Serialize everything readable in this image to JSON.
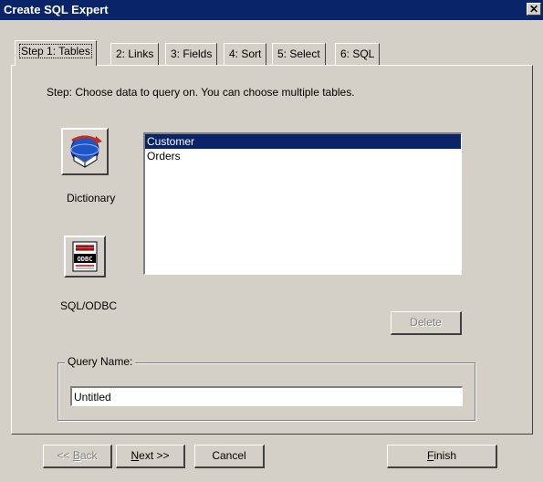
{
  "window": {
    "title": "Create SQL Expert",
    "close_glyph": "✕"
  },
  "tabs": [
    {
      "label": "Step 1: Tables",
      "active": true
    },
    {
      "label": "2: Links",
      "active": false
    },
    {
      "label": "3: Fields",
      "active": false
    },
    {
      "label": "4: Sort",
      "active": false
    },
    {
      "label": "5: Select",
      "active": false
    },
    {
      "label": "6: SQL",
      "active": false
    }
  ],
  "step": {
    "instruction": "Step: Choose data to query on. You can choose multiple tables."
  },
  "sources": {
    "dictionary": {
      "label": "Dictionary",
      "icon": "dictionary-icon"
    },
    "odbc": {
      "label": "SQL/ODBC",
      "icon": "odbc-icon",
      "icon_text": "ODBC"
    }
  },
  "tables": {
    "items": [
      {
        "label": "Customer",
        "selected": true
      },
      {
        "label": "Orders",
        "selected": false
      }
    ]
  },
  "delete_button": {
    "label": "Delete",
    "enabled": false
  },
  "query": {
    "group_label": "Query Name:",
    "value": "Untitled"
  },
  "footer": {
    "back": {
      "prefix": "<< ",
      "accel": "B",
      "rest": "ack",
      "enabled": false
    },
    "next": {
      "accel": "N",
      "rest": "ext >>"
    },
    "cancel": "Cancel",
    "finish": {
      "accel": "F",
      "rest": "inish"
    }
  },
  "colors": {
    "titlebar": "#0a246a",
    "face": "#d4d0c8",
    "selection": "#0a246a"
  }
}
